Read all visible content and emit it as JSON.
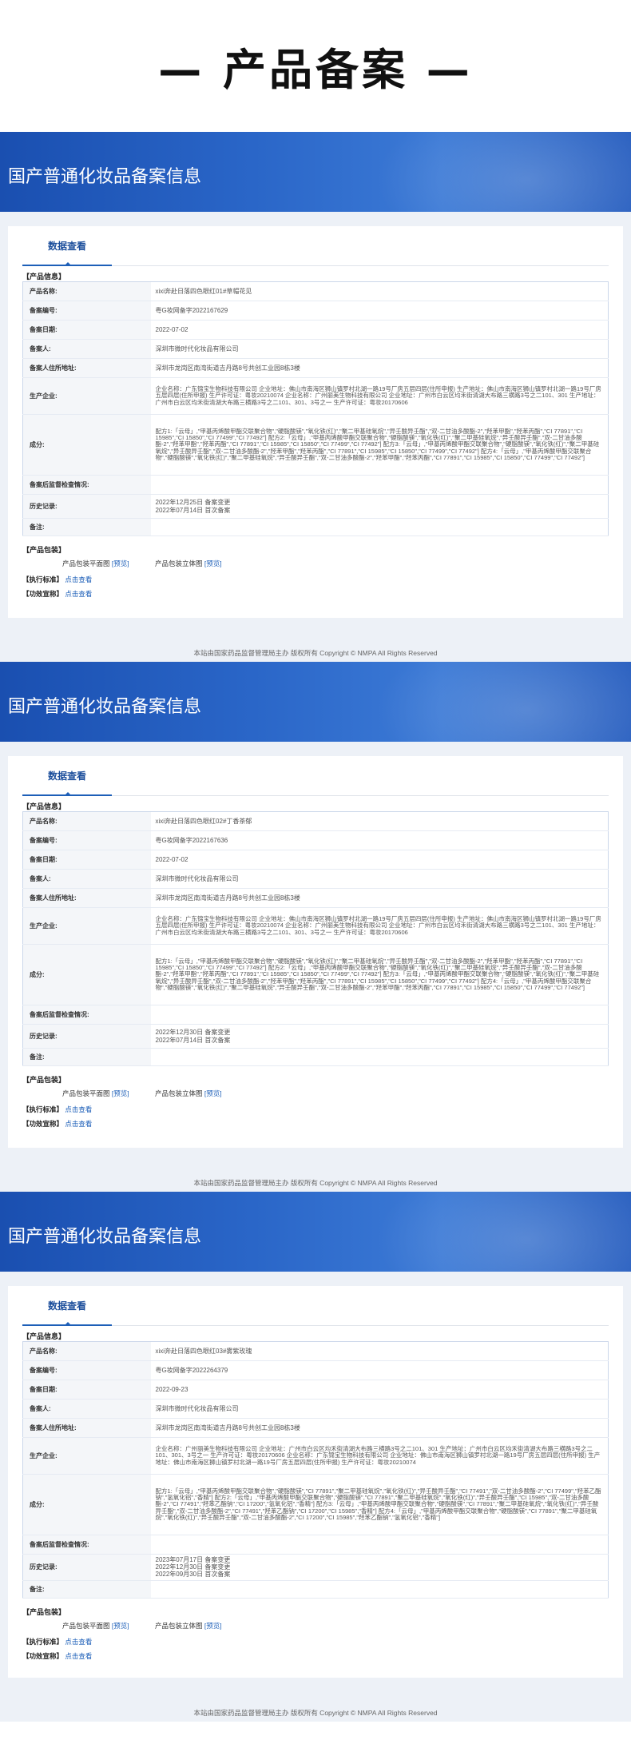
{
  "page_title": "— 产品备案 —",
  "banner_title": "国产普通化妆品备案信息",
  "tab_label": "数据查看",
  "group_product_info": "【产品信息】",
  "group_product_package": "【产品包装】",
  "labels": {
    "name": "产品名称:",
    "reg_no": "备案编号:",
    "date": "备案日期:",
    "person": "备案人:",
    "person_address": "备案人住所地址:",
    "producer": "生产企业:",
    "ingredients": "成分:",
    "post_check": "备案后监督检查情况:",
    "history": "历史记录:",
    "remark": "备注:"
  },
  "package": {
    "flat_label": "产品包装平面图",
    "flat_link": "[预览]",
    "solid_label": "产品包装立体图",
    "solid_link": "[预览]"
  },
  "standard_label": "【执行标准】",
  "standard_link": "点击查看",
  "efficacy_label": "【功效宣称】",
  "efficacy_link": "点击查看",
  "footer": "本站由国家药品监督管理局主办 版权所有 Copyright © NMPA All Rights Reserved",
  "records": [
    {
      "name": "xixi奔赴日落四色眼红01#草帽花见",
      "reg_no": "粤G妆网备字2022167629",
      "date": "2022-07-02",
      "person": "深圳市微时代化妆品有限公司",
      "person_address": "深圳市龙岗区南湾街道吉丹路8号共创工业园8栋3楼",
      "producer": "企业名称：广东锦宝生物科技有限公司 企业地址：佛山市南海区狮山镇罗村北湖一路19号厂房五层四层(住所申报) 生产地址：佛山市南海区狮山镇罗村北湖一路19号厂房五层四层(住所申报) 生产许可证：粤妆20210074 企业名称：广州丽美生物科技有限公司 企业地址：广州市白云区均禾街清湖大布路三横路3号之二101、301 生产地址：广州市白云区均禾街清湖大布路三横路3号之二101、301、3号之一 生产许可证：粤妆20170606",
      "ingredients": "配方1:「云母」,\"甲基丙烯酸甲酯交联聚合物\",\"硬脂酸镁\",\"氧化铁(红)\",\"聚二甲基硅氧烷\",\"异壬酸异壬酯\",\"双-二甘油多酸酯-2\",\"羟苯甲酯\",\"羟苯丙酯\",\"CI 77891\",\"CI 15985\",\"CI 15850\",\"CI 77499\",\"CI 77492\"] 配方2:「云母」,\"甲基丙烯酸甲酯交联聚合物\",\"硬脂酸镁\",\"氧化铁(红)\",\"聚二甲基硅氧烷\",\"异壬酸异壬酯\",\"双-二甘油多酸酯-2\",\"羟苯甲酯\",\"羟苯丙酯\",\"CI 77891\",\"CI 15985\",\"CI 15850\",\"CI 77499\",\"CI 77492\"] 配方3:「云母」,\"甲基丙烯酸甲酯交联聚合物\",\"硬脂酸镁\",\"氧化铁(红)\",\"聚二甲基硅氧烷\",\"异壬酸异壬酯\",\"双-二甘油多酸酯-2\",\"羟苯甲酯\",\"羟苯丙酯\",\"CI 77891\",\"CI 15985\",\"CI 15850\",\"CI 77499\",\"CI 77492\"] 配方4:「云母」,\"甲基丙烯酸甲酯交联聚合物\",\"硬脂酸镁\",\"氧化铁(红)\",\"聚二甲基硅氧烷\",\"异壬酸异壬酯\",\"双-二甘油多酸酯-2\",\"羟苯甲酯\",\"羟苯丙酯\",\"CI 77891\",\"CI 15985\",\"CI 15850\",\"CI 77499\",\"CI 77492\"]",
      "post_check": "",
      "history": [
        "2022年12月25日 备案变更",
        "2022年07月14日 首次备案"
      ],
      "remark": ""
    },
    {
      "name": "xixi奔赴日落四色眼红02#丁香茶郁",
      "reg_no": "粤G妆网备字2022167636",
      "date": "2022-07-02",
      "person": "深圳市微时代化妆品有限公司",
      "person_address": "深圳市龙岗区南湾街道吉丹路8号共创工业园8栋3楼",
      "producer": "企业名称：广东锦宝生物科技有限公司 企业地址：佛山市南海区狮山镇罗村北湖一路19号厂房五层四层(住所申报) 生产地址：佛山市南海区狮山镇罗村北湖一路19号厂房五层四层(住所申报) 生产许可证：粤妆20210074 企业名称：广州丽美生物科技有限公司 企业地址：广州市白云区均禾街清湖大布路三横路3号之二101、301 生产地址：广州市白云区均禾街清湖大布路三横路3号之二101、301、3号之一 生产许可证：粤妆20170606",
      "ingredients": "配方1:「云母」,\"甲基丙烯酸甲酯交联聚合物\",\"硬脂酸镁\",\"氧化铁(红)\",\"聚二甲基硅氧烷\",\"异壬酸异壬酯\",\"双-二甘油多酸酯-2\",\"羟苯甲酯\",\"羟苯丙酯\",\"CI 77891\",\"CI 15985\",\"CI 15850\",\"CI 77499\",\"CI 77492\"] 配方2:「云母」,\"甲基丙烯酸甲酯交联聚合物\",\"硬脂酸镁\",\"氧化铁(红)\",\"聚二甲基硅氧烷\",\"异壬酸异壬酯\",\"双-二甘油多酸酯-2\",\"羟苯甲酯\",\"羟苯丙酯\",\"CI 77891\",\"CI 15985\",\"CI 15850\",\"CI 77499\",\"CI 77492\"] 配方3:「云母」,\"甲基丙烯酸甲酯交联聚合物\",\"硬脂酸镁\",\"氧化铁(红)\",\"聚二甲基硅氧烷\",\"异壬酸异壬酯\",\"双-二甘油多酸酯-2\",\"羟苯甲酯\",\"羟苯丙酯\",\"CI 77891\",\"CI 15985\",\"CI 15850\",\"CI 77499\",\"CI 77492\"] 配方4:「云母」,\"甲基丙烯酸甲酯交联聚合物\",\"硬脂酸镁\",\"氧化铁(红)\",\"聚二甲基硅氧烷\",\"异壬酸异壬酯\",\"双-二甘油多酸酯-2\",\"羟苯甲酯\",\"羟苯丙酯\",\"CI 77891\",\"CI 15985\",\"CI 15850\",\"CI 77499\",\"CI 77492\"]",
      "post_check": "",
      "history": [
        "2022年12月30日 备案变更",
        "2022年07月14日 首次备案"
      ],
      "remark": ""
    },
    {
      "name": "xixi奔赴日落四色眼红03#雾紫玫瑰",
      "reg_no": "粤G妆网备字2022264379",
      "date": "2022-09-23",
      "person": "深圳市微时代化妆品有限公司",
      "person_address": "深圳市龙岗区南湾街道吉丹路8号共创工业园8栋3楼",
      "producer": "企业名称：广州丽美生物科技有限公司 企业地址：广州市白云区均禾街清湖大布路三横路3号之二101、301 生产地址：广州市白云区均禾街清湖大布路三横路3号之二101、301、3号之一 生产许可证：粤妆20170606 企业名称：广东锦宝生物科技有限公司 企业地址：佛山市南海区狮山镇罗村北湖一路19号厂房五层四层(住所申报) 生产地址：佛山市南海区狮山镇罗村北湖一路19号厂房五层四层(住所申报) 生产许可证：粤妆20210074",
      "ingredients": "配方1:「云母」,\"甲基丙烯酸甲酯交联聚合物\",\"硬脂酸镁\",\"CI 77891\",\"聚二甲基硅氧烷\",\"氧化铁(红)\",\"异壬酸异壬酯\",\"CI 77491\",\"双-二甘油多酸酯-2\",\"CI 77499\",\"羟苯乙酯钠\",\"氢氧化铝\",\"香精\"] 配方2:「云母」,\"甲基丙烯酸甲酯交联聚合物\",\"硬脂酸镁\",\"CI 77891\",\"聚二甲基硅氧烷\",\"氧化铁(红)\",\"异壬酸异壬酯\",\"CI 15985\",\"双-二甘油多酸酯-2\",\"CI 77491\",\"羟苯乙酯钠\",\"CI 17200\",\"氢氧化铝\",\"香精\"] 配方3:「云母」,\"甲基丙烯酸甲酯交联聚合物\",\"硬脂酸镁\",\"CI 77891\",\"聚二甲基硅氧烷\",\"氧化铁(红)\",\"异壬酸异壬酯\",\"双-二甘油多酸酯-2\",\"CI 77491\",\"羟苯乙酯钠\",\"CI 17200\",\"CI 15985\",\"香精\"] 配方4:「云母」,\"甲基丙烯酸甲酯交联聚合物\",\"硬脂酸镁\",\"CI 77891\",\"聚二甲基硅氧烷\",\"氧化铁(红)\",\"异壬酸异壬酯\",\"双-二甘油多酸酯-2\",\"CI 17200\",\"CI 15985\",\"羟苯乙酯钠\",\"氢氧化铝\",\"香精\"]",
      "post_check": "",
      "history": [
        "2023年07月17日 备案变更",
        "2022年12月30日 备案变更",
        "2022年09月30日 首次备案"
      ],
      "remark": ""
    }
  ]
}
